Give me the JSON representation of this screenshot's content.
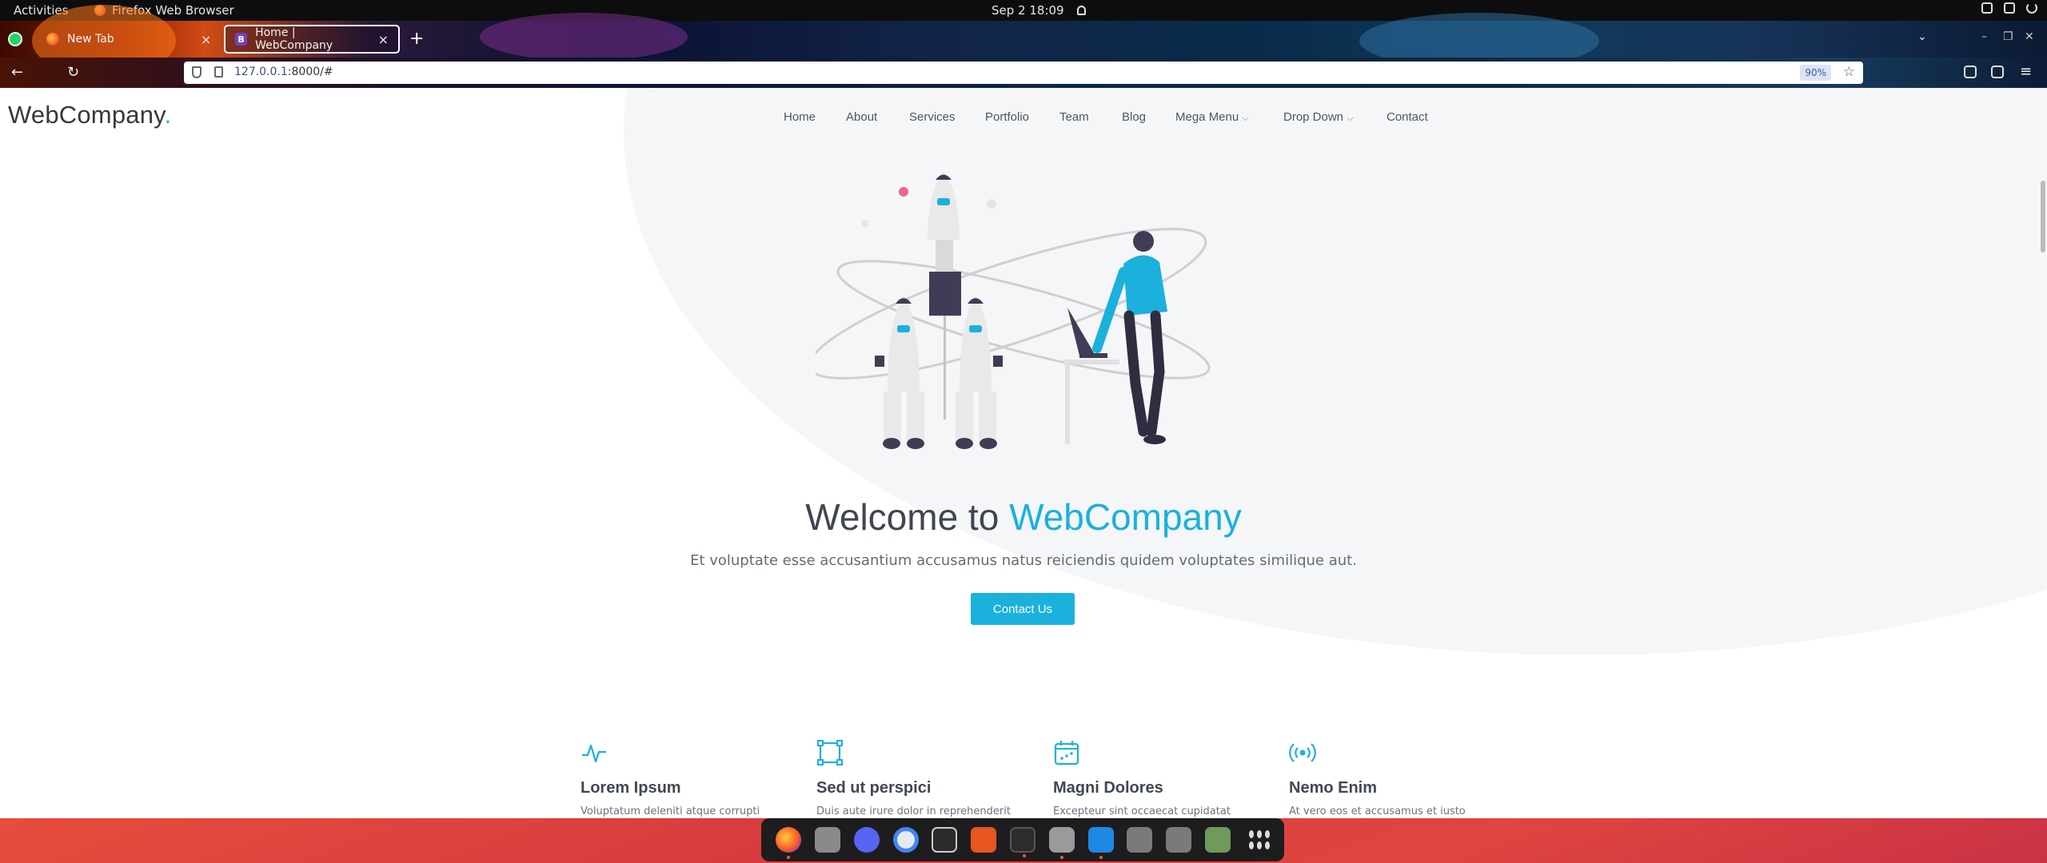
{
  "topbar": {
    "activities": "Activities",
    "app_name": "Firefox Web Browser",
    "datetime": "Sep 2  18:09"
  },
  "browser": {
    "tabs": [
      {
        "title": "New Tab",
        "icon": "firefox-icon",
        "active": false
      },
      {
        "title": "Home | WebCompany",
        "icon": "bootstrap-icon",
        "active": true
      }
    ],
    "url_host": "127.0.0.1",
    "url_rest": ":8000/#",
    "zoom": "90%"
  },
  "site": {
    "brand": "WebCompany",
    "brand_dot": ".",
    "nav": [
      "Home",
      "About",
      "Services",
      "Portfolio",
      "Team",
      "Blog",
      "Mega Menu",
      "Drop Down",
      "Contact"
    ],
    "hero": {
      "title_prefix": "Welcome to ",
      "title_accent": "WebCompany",
      "subtitle": "Et voluptate esse accusantium accusamus natus reiciendis quidem voluptates similique aut.",
      "cta": "Contact Us"
    },
    "features": [
      {
        "icon": "pulse-icon",
        "title": "Lorem Ipsum",
        "text": "Voluptatum deleniti atque corrupti"
      },
      {
        "icon": "bounding-box-icon",
        "title": "Sed ut perspici",
        "text": "Duis aute irure dolor in reprehenderit"
      },
      {
        "icon": "calendar-icon",
        "title": "Magni Dolores",
        "text": "Excepteur sint occaecat cupidatat"
      },
      {
        "icon": "broadcast-icon",
        "title": "Nemo Enim",
        "text": "At vero eos et accusamus et iusto"
      }
    ]
  },
  "colors": {
    "accent": "#1bb1dc",
    "dock": "#e0453f"
  },
  "dock_apps": [
    "firefox-icon",
    "files-icon",
    "discord-icon",
    "chrome-icon",
    "unity-icon",
    "software-center-icon",
    "terminal-icon",
    "settings-icon",
    "vscode-icon",
    "drive-icon",
    "drive-icon",
    "trash-icon",
    "apps-grid-icon"
  ]
}
